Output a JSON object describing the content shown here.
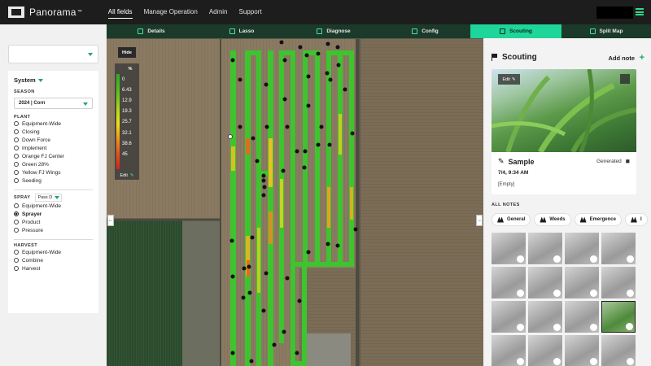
{
  "app": {
    "name": "Panorama",
    "tm": "™"
  },
  "topnav": [
    "All fields",
    "Manage Operation",
    "Admin",
    "Support"
  ],
  "tabs": [
    {
      "label": "Details",
      "icon": "details-icon"
    },
    {
      "label": "Lasso",
      "icon": "lasso-icon"
    },
    {
      "label": "Diagnose",
      "icon": "diagnose-icon"
    },
    {
      "label": "Config",
      "icon": "gear-icon"
    },
    {
      "label": "Scouting",
      "icon": "flag-icon"
    },
    {
      "label": "Split Map",
      "icon": "split-map-icon"
    }
  ],
  "sidebar": {
    "system_label": "System",
    "season_label": "SEASON",
    "season_value": "2024 | Corn",
    "plant_label": "PLANT",
    "plant_items": [
      "Equipment-Wide",
      "Closing",
      "Down Force",
      "Implement",
      "Orange FJ Center",
      "Green 28%",
      "Yellow FJ Wings",
      "Seeding"
    ],
    "spray_label": "SPRAY",
    "spray_pass": "Pass D",
    "spray_items": [
      "Equipment-Wide",
      "Sprayer",
      "Product",
      "Pressure"
    ],
    "spray_selected": "Sprayer",
    "harvest_label": "HARVEST",
    "harvest_items": [
      "Equipment-Wide",
      "Combine",
      "Harvest"
    ]
  },
  "legend": {
    "hide": "Hide",
    "unit": "%",
    "values": [
      "0",
      "6.43",
      "12.9",
      "19.3",
      "25.7",
      "32.1",
      "38.6",
      "45"
    ],
    "edit": "Edit"
  },
  "scouting": {
    "title": "Scouting",
    "add_note": "Add note",
    "photo_edit": "Edit",
    "sample_name": "Sample",
    "generated": "Generated",
    "date": "7/4, 9:34 AM",
    "body": "[Empty]",
    "all_notes": "ALL NOTES",
    "filters": [
      "General",
      "Weeds",
      "Emergence",
      "I"
    ]
  },
  "colors": {
    "accent": "#1ed59a",
    "tabbar": "#1b3a2a",
    "topbar": "#1d1d1d",
    "green_mark": "#1ea866"
  }
}
